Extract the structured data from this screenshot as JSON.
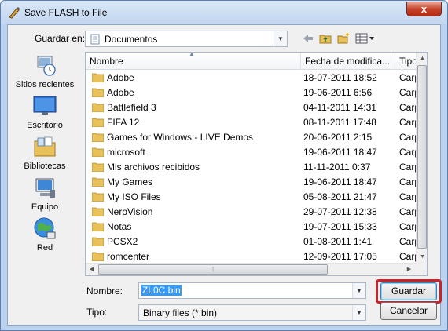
{
  "window": {
    "title": "Save FLASH to File",
    "close_label": "x"
  },
  "location": {
    "label": "Guardar en:",
    "value": "Documentos"
  },
  "toolbar": {
    "icons": [
      "back-icon",
      "up-folder-icon",
      "new-folder-icon",
      "view-menu-icon"
    ]
  },
  "places": [
    {
      "label": "Sitios recientes",
      "icon": "recent-places-icon"
    },
    {
      "label": "Escritorio",
      "icon": "desktop-icon"
    },
    {
      "label": "Bibliotecas",
      "icon": "libraries-icon"
    },
    {
      "label": "Equipo",
      "icon": "computer-icon"
    },
    {
      "label": "Red",
      "icon": "network-icon"
    }
  ],
  "columns": [
    "Nombre",
    "Fecha de modifica...",
    "Tipo"
  ],
  "files": [
    {
      "name": "Adobe",
      "date": "18-07-2011 18:52",
      "type": "Carpet"
    },
    {
      "name": "Adobe",
      "date": "19-06-2011 6:56",
      "type": "Carpet"
    },
    {
      "name": "Battlefield 3",
      "date": "04-11-2011 14:31",
      "type": "Carpet"
    },
    {
      "name": "FIFA 12",
      "date": "08-11-2011 17:48",
      "type": "Carpet"
    },
    {
      "name": "Games for Windows - LIVE Demos",
      "date": "20-06-2011 2:15",
      "type": "Carpet"
    },
    {
      "name": "microsoft",
      "date": "19-06-2011 18:47",
      "type": "Carpet"
    },
    {
      "name": "Mis archivos recibidos",
      "date": "11-11-2011 0:37",
      "type": "Carpet"
    },
    {
      "name": "My Games",
      "date": "19-06-2011 18:47",
      "type": "Carpet"
    },
    {
      "name": "My ISO Files",
      "date": "05-08-2011 21:47",
      "type": "Carpet"
    },
    {
      "name": "NeroVision",
      "date": "29-07-2011 12:38",
      "type": "Carpet"
    },
    {
      "name": "Notas",
      "date": "19-07-2011 15:33",
      "type": "Carpet"
    },
    {
      "name": "PCSX2",
      "date": "01-08-2011 1:41",
      "type": "Carpet"
    },
    {
      "name": "romcenter",
      "date": "12-09-2011 17:05",
      "type": "Carpet"
    }
  ],
  "filename": {
    "label": "Nombre:",
    "value": "ZL0C.bin"
  },
  "filetype": {
    "label": "Tipo:",
    "value": "Binary files (*.bin)"
  },
  "buttons": {
    "save": "Guardar",
    "cancel": "Cancelar"
  },
  "colors": {
    "highlight": "#c8232c",
    "selection": "#3399ff",
    "folder": "#e8c15a"
  }
}
